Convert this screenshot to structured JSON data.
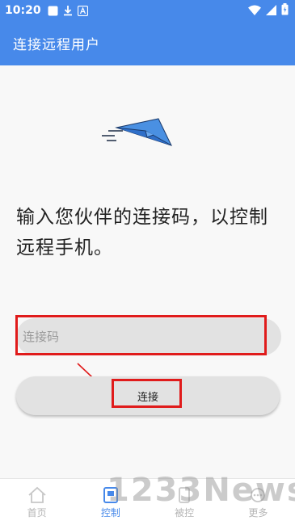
{
  "status_bar": {
    "time": "10:20",
    "left_icons": [
      "notification-square-icon",
      "download-icon",
      "app-a-icon"
    ],
    "right_icons": [
      "wifi-icon",
      "signal-icon",
      "battery-icon"
    ]
  },
  "app_bar": {
    "title": "连接远程用户",
    "color": "#4789ea"
  },
  "illustration": {
    "icon": "paper-plane-icon",
    "color": "#4a90e2"
  },
  "main": {
    "prompt": "输入您伙伴的连接码，以控制远程手机。",
    "code_input": {
      "placeholder": "连接码",
      "value": ""
    },
    "connect_label": "连接"
  },
  "annotations": {
    "highlight_color": "#e01b1b"
  },
  "bottom_nav": {
    "items": [
      {
        "label": "首页",
        "icon": "home-icon"
      },
      {
        "label": "控制",
        "icon": "remote-control-icon"
      },
      {
        "label": "被控",
        "icon": "controlled-icon"
      },
      {
        "label": "更多",
        "icon": "more-icon"
      }
    ],
    "active_index": 1
  },
  "watermark": "1233News"
}
